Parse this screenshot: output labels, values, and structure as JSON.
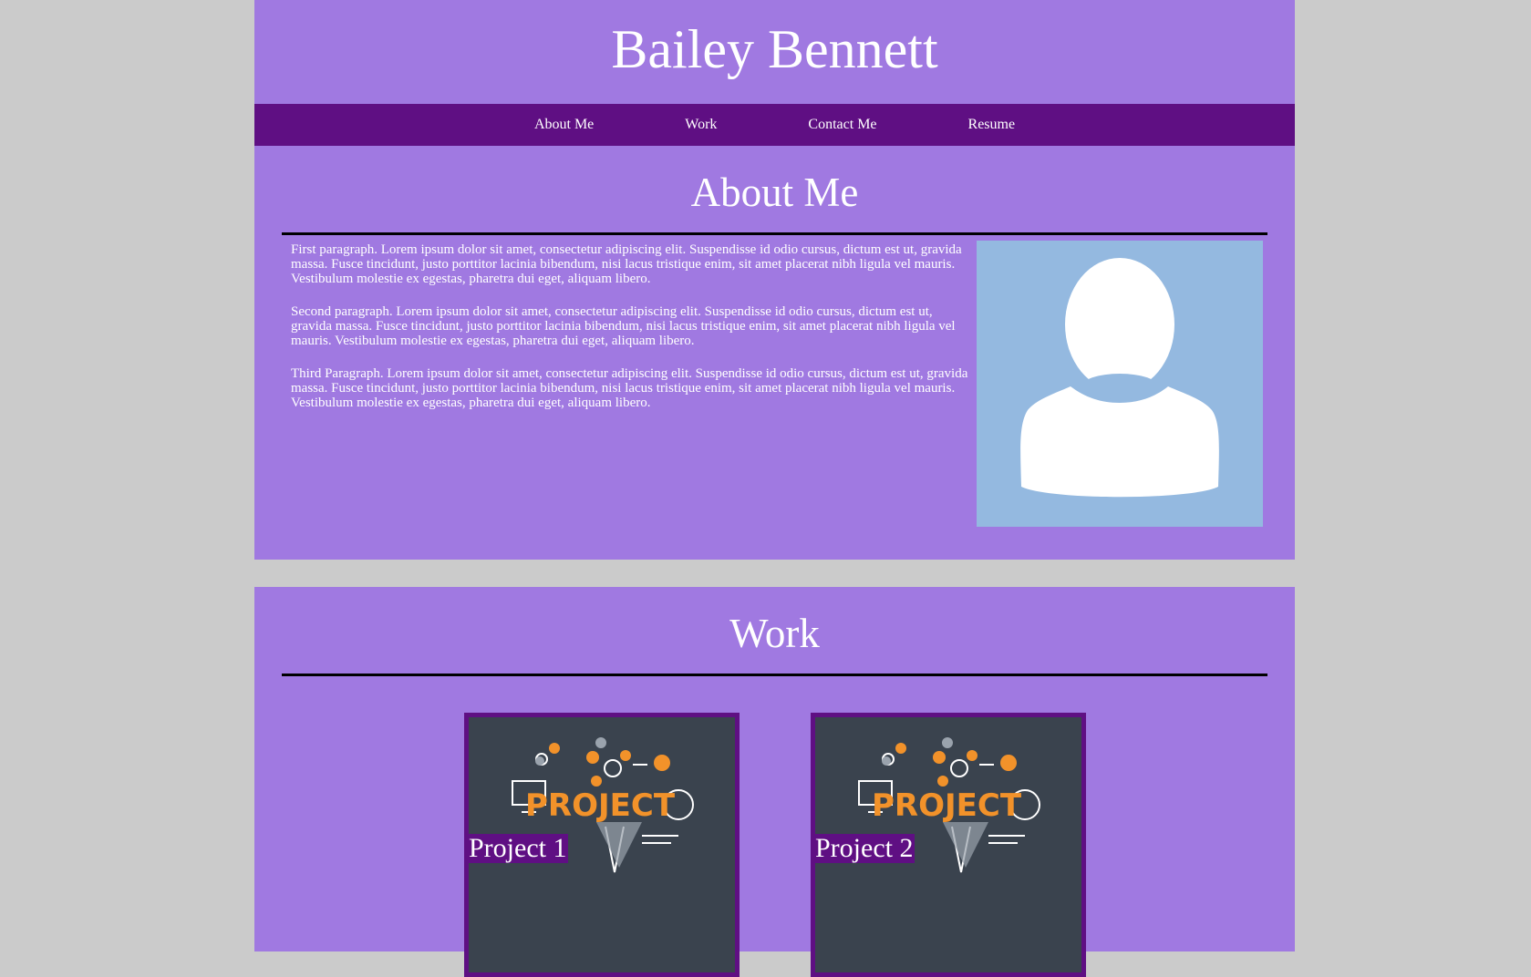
{
  "header": {
    "title": "Bailey Bennett"
  },
  "nav": {
    "items": [
      {
        "label": "About Me"
      },
      {
        "label": "Work"
      },
      {
        "label": "Contact Me"
      },
      {
        "label": "Resume"
      }
    ]
  },
  "about": {
    "title": "About Me",
    "paragraphs": [
      "First paragraph. Lorem ipsum dolor sit amet, consectetur adipiscing elit. Suspendisse id odio cursus, dictum est ut, gravida massa. Fusce tincidunt, justo porttitor lacinia bibendum, nisi lacus tristique enim, sit amet placerat nibh ligula vel mauris. Vestibulum molestie ex egestas, pharetra dui eget, aliquam libero.",
      "Second paragraph. Lorem ipsum dolor sit amet, consectetur adipiscing elit. Suspendisse id odio cursus, dictum est ut, gravida massa. Fusce tincidunt, justo porttitor lacinia bibendum, nisi lacus tristique enim, sit amet placerat nibh ligula vel mauris. Vestibulum molestie ex egestas, pharetra dui eget, aliquam libero.",
      "Third Paragraph. Lorem ipsum dolor sit amet, consectetur adipiscing elit. Suspendisse id odio cursus, dictum est ut, gravida massa. Fusce tincidunt, justo porttitor lacinia bibendum, nisi lacus tristique enim, sit amet placerat nibh ligula vel mauris. Vestibulum molestie ex egestas, pharetra dui eget, aliquam libero."
    ],
    "avatar_icon": "user-silhouette-icon"
  },
  "work": {
    "title": "Work",
    "projects": [
      {
        "label": "Project 1",
        "image_word": "PROJECT"
      },
      {
        "label": "Project 2",
        "image_word": "PROJECT"
      }
    ]
  },
  "colors": {
    "page_bg": "#cbcbcb",
    "panel_bg": "#a079e1",
    "nav_bg": "#5f0f83",
    "avatar_bg": "#94b9e0",
    "project_bg": "#3a434e",
    "accent_orange": "#f2922a"
  }
}
